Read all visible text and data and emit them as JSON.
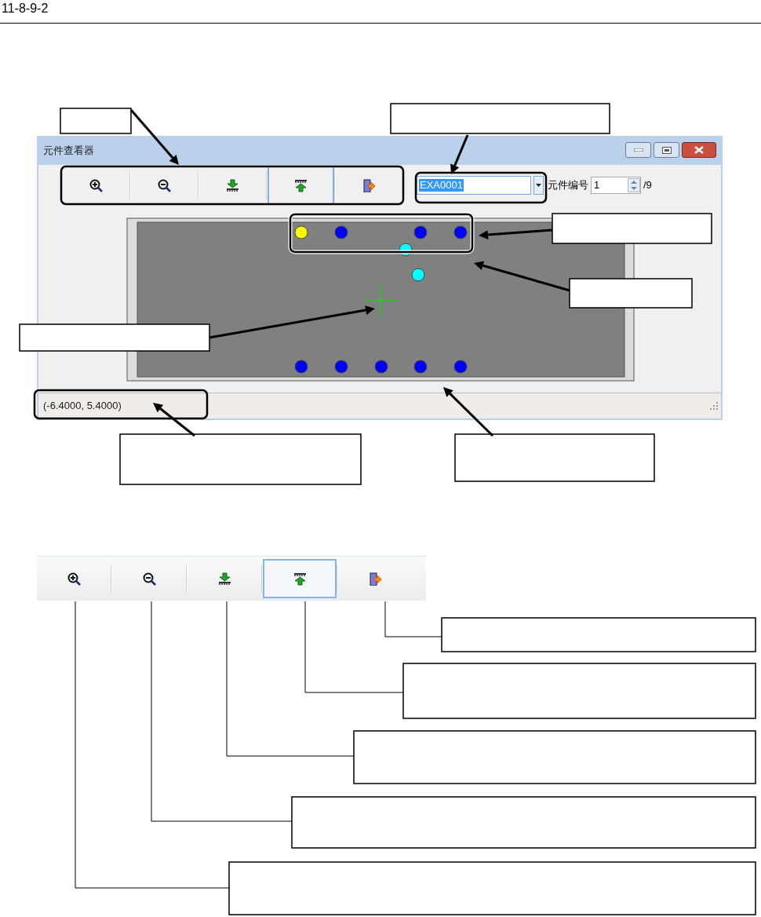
{
  "page_header": {
    "label": "11-8-9-2"
  },
  "viewer_window": {
    "title": "元件查看器",
    "toolbar": [
      {
        "kind": "zoom-in",
        "selected": false
      },
      {
        "kind": "zoom-out",
        "selected": false
      },
      {
        "kind": "move-down",
        "selected": false
      },
      {
        "kind": "move-up",
        "selected": true
      },
      {
        "kind": "exit",
        "selected": false
      }
    ],
    "component_field": {
      "value": "EXA0001"
    },
    "number_label": "元件编号",
    "number_field": {
      "value": "1"
    },
    "total": "/9",
    "holes": [
      {
        "color": "#ffff00"
      },
      {
        "color": "#0000ff"
      },
      {
        "color": "#0000ff"
      },
      {
        "color": "#0000ff"
      },
      {
        "color": "#00ffff"
      },
      {
        "color": "#00ffff"
      },
      {
        "color": "#0000ff"
      },
      {
        "color": "#0000ff"
      },
      {
        "color": "#0000ff"
      },
      {
        "color": "#0000ff"
      },
      {
        "color": "#0000ff"
      }
    ],
    "status_text": "(-6.4000, 5.4000)"
  },
  "toolbar_detail": [
    {
      "kind": "zoom-in",
      "selected": false
    },
    {
      "kind": "zoom-out",
      "selected": false
    },
    {
      "kind": "move-down",
      "selected": false
    },
    {
      "kind": "move-up",
      "selected": true
    },
    {
      "kind": "exit",
      "selected": false
    }
  ]
}
